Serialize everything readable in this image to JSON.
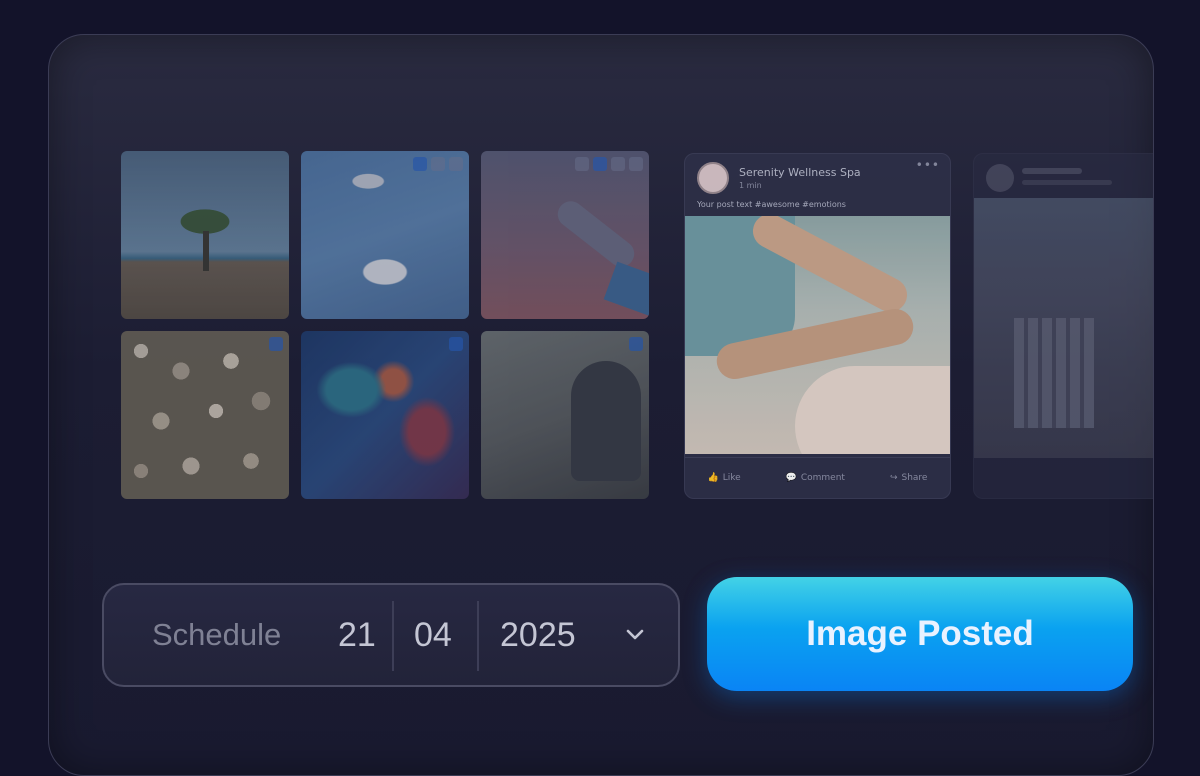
{
  "schedule": {
    "label": "Schedule",
    "day": "21",
    "month": "04",
    "year": "2025"
  },
  "cta": {
    "label": "Image Posted"
  },
  "post": {
    "page_name": "Serenity Wellness Spa",
    "time": "1 min",
    "caption": "Your post text #awesome #emotions",
    "actions": [
      "Like",
      "Comment",
      "Share"
    ]
  },
  "colors": {
    "accent_top": "#43d2e6",
    "accent_bottom": "#0a84f5",
    "background": "#13132a"
  }
}
